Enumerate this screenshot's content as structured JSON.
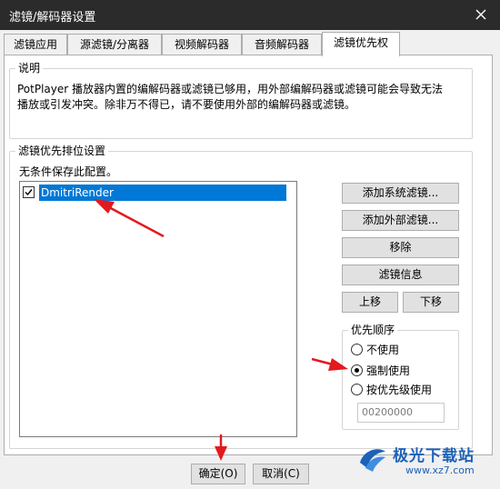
{
  "window": {
    "title": "滤镜/解码器设置"
  },
  "tabs": [
    {
      "label": "滤镜应用"
    },
    {
      "label": "源滤镜/分离器"
    },
    {
      "label": "视频解码器"
    },
    {
      "label": "音频解码器"
    },
    {
      "label": "滤镜优先权"
    }
  ],
  "description": {
    "title": "说明",
    "text": "PotPlayer 播放器内置的编解码器或滤镜已够用，用外部编解码器或滤镜可能会导致无法播放或引发冲突。除非万不得已，请不要使用外部的编解码器或滤镜。"
  },
  "priority_group": {
    "title": "滤镜优先排位设置",
    "note": "无条件保存此配置。",
    "list": [
      {
        "label": "DmitriRender",
        "checked": true
      }
    ],
    "buttons": {
      "add_system": "添加系统滤镜...",
      "add_external": "添加外部滤镜...",
      "remove": "移除",
      "filter_info": "滤镜信息",
      "move_up": "上移",
      "move_down": "下移"
    },
    "order": {
      "title": "优先顺序",
      "options": [
        {
          "label": "不使用",
          "selected": false
        },
        {
          "label": "强制使用",
          "selected": true
        },
        {
          "label": "按优先级使用",
          "selected": false
        }
      ],
      "value": "00200000"
    }
  },
  "footer": {
    "ok": "确定(O)",
    "cancel": "取消(C)"
  },
  "watermark": {
    "name": "极光下载站",
    "url": "www.xz7.com"
  },
  "colors": {
    "titlebar": "#2b2b2b",
    "selection": "#0078d7",
    "arrow": "#e3191e",
    "watermark": "#1c62b9"
  }
}
